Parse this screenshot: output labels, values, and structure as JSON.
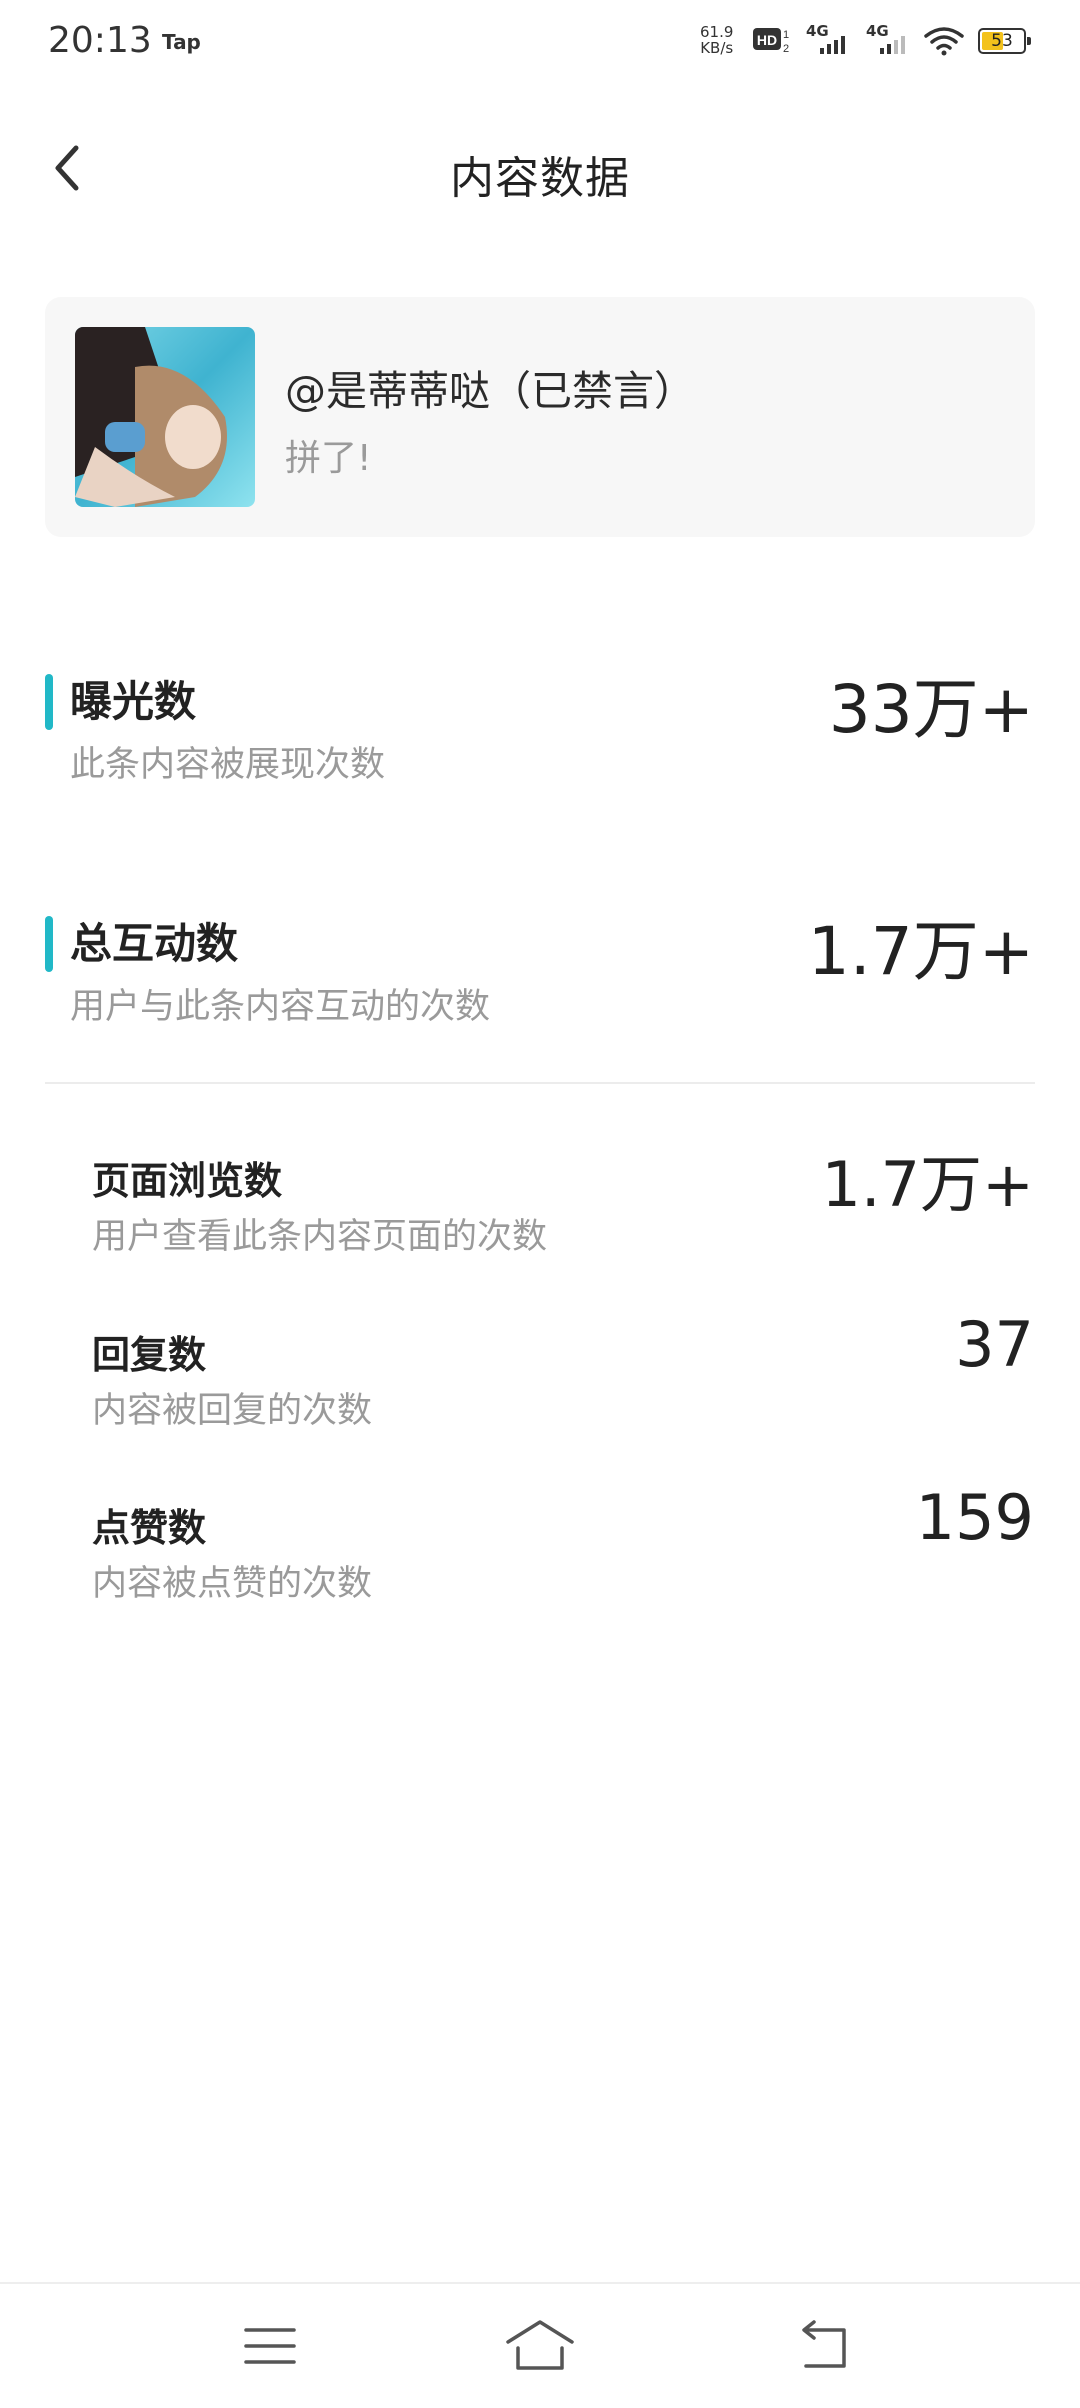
{
  "status_bar": {
    "time": "20:13",
    "app_label": "Tap",
    "net_speed_value": "61.9",
    "net_speed_unit": "KB/s",
    "signal_1": "4G",
    "signal_2": "4G",
    "battery_level": "53",
    "battery_color": "#f3c21c"
  },
  "header": {
    "title": "内容数据",
    "back_icon": "chevron-left-icon"
  },
  "post": {
    "author": "@是蒂蒂哒（已禁言）",
    "text": "拼了!"
  },
  "stats": {
    "exposure": {
      "label": "曝光数",
      "desc": "此条内容被展现次数",
      "value": "33万+"
    },
    "interaction": {
      "label": "总互动数",
      "desc": "用户与此条内容互动的次数",
      "value": "1.7万+"
    },
    "page_views": {
      "label": "页面浏览数",
      "desc": "用户查看此条内容页面的次数",
      "value": "1.7万+"
    },
    "replies": {
      "label": "回复数",
      "desc": "内容被回复的次数",
      "value": "37"
    },
    "likes": {
      "label": "点赞数",
      "desc": "内容被点赞的次数",
      "value": "159"
    }
  },
  "accent_color": "#21b8c7",
  "nav_bar": {
    "menu_icon": "menu-icon",
    "home_icon": "home-icon",
    "back_icon": "back-arrow-icon"
  }
}
